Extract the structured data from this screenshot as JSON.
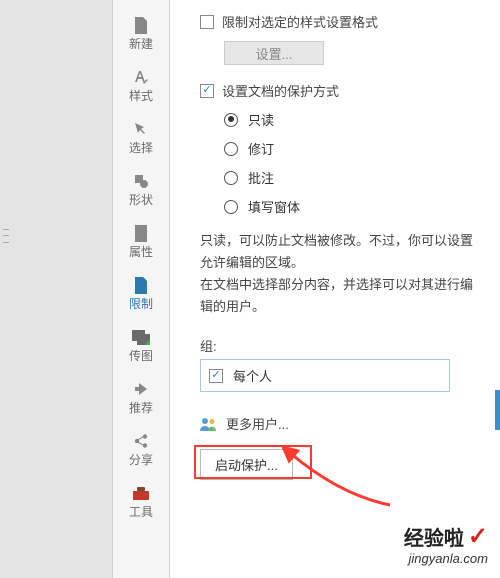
{
  "sidebar": {
    "items": [
      {
        "label": "新建"
      },
      {
        "label": "样式"
      },
      {
        "label": "选择"
      },
      {
        "label": "形状"
      },
      {
        "label": "属性"
      },
      {
        "label": "限制"
      },
      {
        "label": "传图"
      },
      {
        "label": "推荐"
      },
      {
        "label": "分享"
      },
      {
        "label": "工具"
      }
    ]
  },
  "panel": {
    "restrict_format_label": "限制对选定的样式设置格式",
    "settings_btn": "设置...",
    "protect_mode_label": "设置文档的保护方式",
    "radios": {
      "readonly": "只读",
      "revision": "修订",
      "comment": "批注",
      "form": "填写窗体"
    },
    "desc_line1": "只读，可以防止文档被修改。不过，你可以设置允许编辑的区域。",
    "desc_line2": "在文档中选择部分内容，并选择可以对其进行编辑的用户。",
    "group_label": "组:",
    "group_value": "每个人",
    "more_users": "更多用户...",
    "start_protect": "启动保护..."
  },
  "watermark": {
    "line1": "经验啦",
    "line2": "jingyanla.com"
  }
}
